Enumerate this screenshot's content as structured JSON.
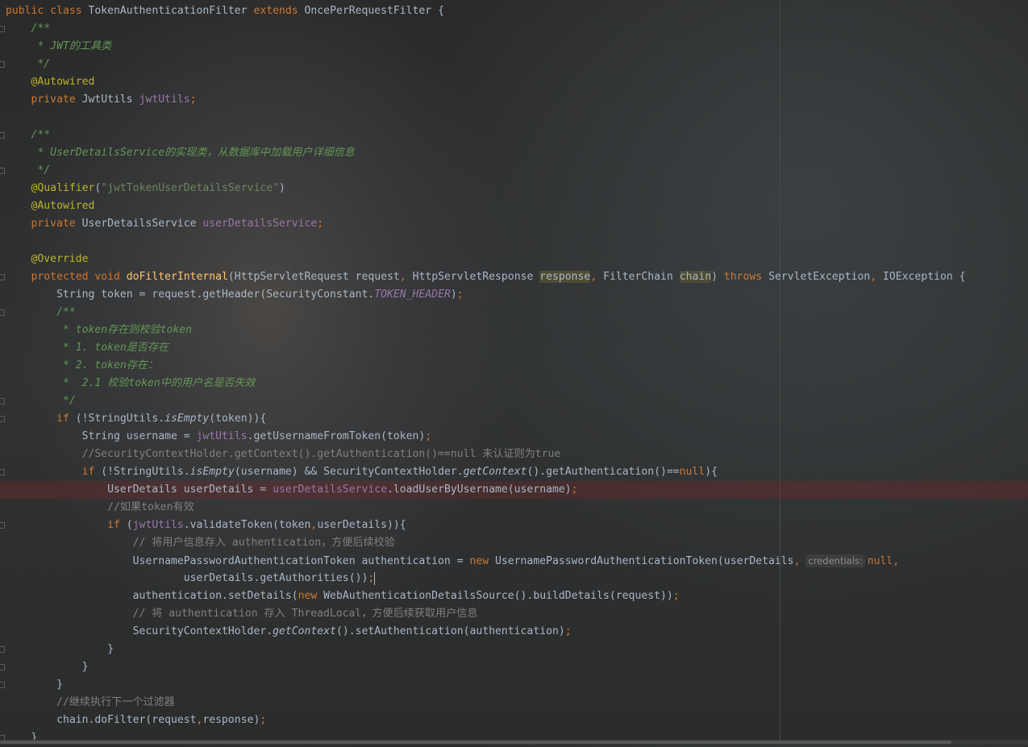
{
  "editor": {
    "colors": {
      "keyword": "#cc7832",
      "text": "#a9b7c6",
      "doc_comment": "#629755",
      "line_comment": "#808080",
      "annotation": "#bbb529",
      "field": "#9876aa",
      "string": "#6a8759",
      "method_decl": "#ffc66d"
    },
    "error_line": 28,
    "cursor_line": 33,
    "lines": [
      [
        [
          "k",
          "public class "
        ],
        [
          "t",
          "TokenAuthenticationFilter "
        ],
        [
          "k",
          "extends "
        ],
        [
          "t",
          "OncePerRequestFilter {"
        ]
      ],
      [
        [
          "c",
          "    /**"
        ]
      ],
      [
        [
          "c",
          "     * JWT的工具类"
        ]
      ],
      [
        [
          "c",
          "     */"
        ]
      ],
      [
        [
          "a",
          "    @Autowired"
        ]
      ],
      [
        [
          "k",
          "    private "
        ],
        [
          "t",
          "JwtUtils "
        ],
        [
          "f",
          "jwtUtils"
        ],
        [
          "k",
          ";"
        ]
      ],
      [],
      [
        [
          "c",
          "    /**"
        ]
      ],
      [
        [
          "c",
          "     * UserDetailsService的实现类，从数据库中加载用户详细信息"
        ]
      ],
      [
        [
          "c",
          "     */"
        ]
      ],
      [
        [
          "a",
          "    @Qualifier"
        ],
        [
          "t",
          "("
        ],
        [
          "s",
          "\"jwtTokenUserDetailsService\""
        ],
        [
          "t",
          ")"
        ]
      ],
      [
        [
          "a",
          "    @Autowired"
        ]
      ],
      [
        [
          "k",
          "    private "
        ],
        [
          "t",
          "UserDetailsService "
        ],
        [
          "f",
          "userDetailsService"
        ],
        [
          "k",
          ";"
        ]
      ],
      [],
      [
        [
          "a",
          "    @Override"
        ]
      ],
      [
        [
          "k",
          "    protected void "
        ],
        [
          "fn",
          "doFilterInternal"
        ],
        [
          "t",
          "(HttpServletRequest request"
        ],
        [
          "k",
          ", "
        ],
        [
          "t",
          "HttpServletResponse "
        ],
        [
          "h",
          "response"
        ],
        [
          "k",
          ", "
        ],
        [
          "t",
          "FilterChain "
        ],
        [
          "h",
          "chain"
        ],
        [
          "t",
          ") "
        ],
        [
          "k",
          "throws "
        ],
        [
          "t",
          "ServletException"
        ],
        [
          "k",
          ", "
        ],
        [
          "t",
          "IOException {"
        ]
      ],
      [
        [
          "t",
          "        String token = request.getHeader(SecurityConstant."
        ],
        [
          "sc",
          "TOKEN_HEADER"
        ],
        [
          "t",
          ")"
        ],
        [
          "k",
          ";"
        ]
      ],
      [
        [
          "c",
          "        /**"
        ]
      ],
      [
        [
          "c",
          "         * token存在则校验token"
        ]
      ],
      [
        [
          "c",
          "         * 1. token是否存在"
        ]
      ],
      [
        [
          "c",
          "         * 2. token存在："
        ]
      ],
      [
        [
          "c",
          "         *  2.1 校验token中的用户名是否失效"
        ]
      ],
      [
        [
          "c",
          "         */"
        ]
      ],
      [
        [
          "k",
          "        if "
        ],
        [
          "t",
          "(!StringUtils."
        ],
        [
          "m",
          "isEmpty"
        ],
        [
          "t",
          "(token)){"
        ]
      ],
      [
        [
          "t",
          "            String username = "
        ],
        [
          "f",
          "jwtUtils"
        ],
        [
          "t",
          ".getUsernameFromToken(token)"
        ],
        [
          "k",
          ";"
        ]
      ],
      [
        [
          "lc",
          "            //SecurityContextHolder.getContext().getAuthentication()==null 未认证则为true"
        ]
      ],
      [
        [
          "k",
          "            if "
        ],
        [
          "t",
          "(!StringUtils."
        ],
        [
          "m",
          "isEmpty"
        ],
        [
          "t",
          "(username) && SecurityContextHolder."
        ],
        [
          "m",
          "getContext"
        ],
        [
          "t",
          "().getAuthentication()=="
        ],
        [
          "k",
          "null"
        ],
        [
          "t",
          "){"
        ]
      ],
      [
        [
          "t",
          "                UserDetails userDetails = "
        ],
        [
          "f",
          "userDetailsService"
        ],
        [
          "t",
          ".loadUserByUsername(username)"
        ],
        [
          "k",
          ";"
        ]
      ],
      [
        [
          "lc",
          "                //如果token有效"
        ]
      ],
      [
        [
          "k",
          "                if "
        ],
        [
          "t",
          "("
        ],
        [
          "f",
          "jwtUtils"
        ],
        [
          "t",
          ".validateToken(token"
        ],
        [
          "k",
          ","
        ],
        [
          "t",
          "userDetails)){"
        ]
      ],
      [
        [
          "lc",
          "                    // 将用户信息存入 authentication，方便后续校验"
        ]
      ],
      [
        [
          "t",
          "                    UsernamePasswordAuthenticationToken authentication = "
        ],
        [
          "k",
          "new "
        ],
        [
          "t",
          "UsernamePasswordAuthenticationToken(userDetails"
        ],
        [
          "k",
          ","
        ],
        [
          "hint",
          "credentials:"
        ],
        [
          "k",
          "null,"
        ]
      ],
      [
        [
          "t",
          "                            userDetails.getAuthorities())"
        ],
        [
          "k",
          ";"
        ]
      ],
      [
        [
          "t",
          "                    authentication.setDetails("
        ],
        [
          "k",
          "new "
        ],
        [
          "t",
          "WebAuthenticationDetailsSource().buildDetails(request))"
        ],
        [
          "k",
          ";"
        ]
      ],
      [
        [
          "lc",
          "                    // 将 authentication 存入 ThreadLocal，方便后续获取用户信息"
        ]
      ],
      [
        [
          "t",
          "                    SecurityContextHolder."
        ],
        [
          "m",
          "getContext"
        ],
        [
          "t",
          "().setAuthentication(authentication)"
        ],
        [
          "k",
          ";"
        ]
      ],
      [
        [
          "t",
          "                }"
        ]
      ],
      [
        [
          "t",
          "            }"
        ]
      ],
      [
        [
          "t",
          "        }"
        ]
      ],
      [
        [
          "lc",
          "        //继续执行下一个过滤器"
        ]
      ],
      [
        [
          "t",
          "        chain.doFilter(request"
        ],
        [
          "k",
          ","
        ],
        [
          "t",
          "response)"
        ],
        [
          "k",
          ";"
        ]
      ],
      [
        [
          "t",
          "    }"
        ]
      ]
    ]
  }
}
